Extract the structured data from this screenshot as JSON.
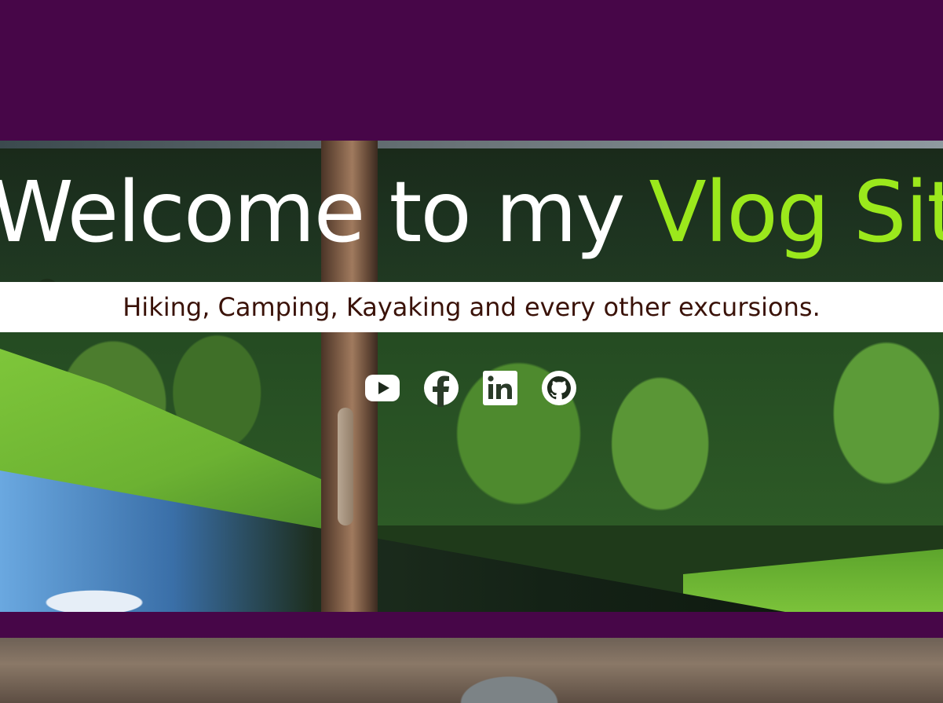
{
  "hero": {
    "title_main": "Welcome to my ",
    "title_accent": "Vlog Site",
    "subtitle": "Hiking, Camping, Kayaking and every other excursions."
  },
  "social": [
    {
      "name": "youtube",
      "icon": "youtube-icon"
    },
    {
      "name": "facebook",
      "icon": "facebook-icon"
    },
    {
      "name": "linkedin",
      "icon": "linkedin-icon"
    },
    {
      "name": "github",
      "icon": "github-icon"
    }
  ],
  "colors": {
    "band": "#470648",
    "accent": "#9be81c",
    "subtitle_text": "#3a1208"
  }
}
